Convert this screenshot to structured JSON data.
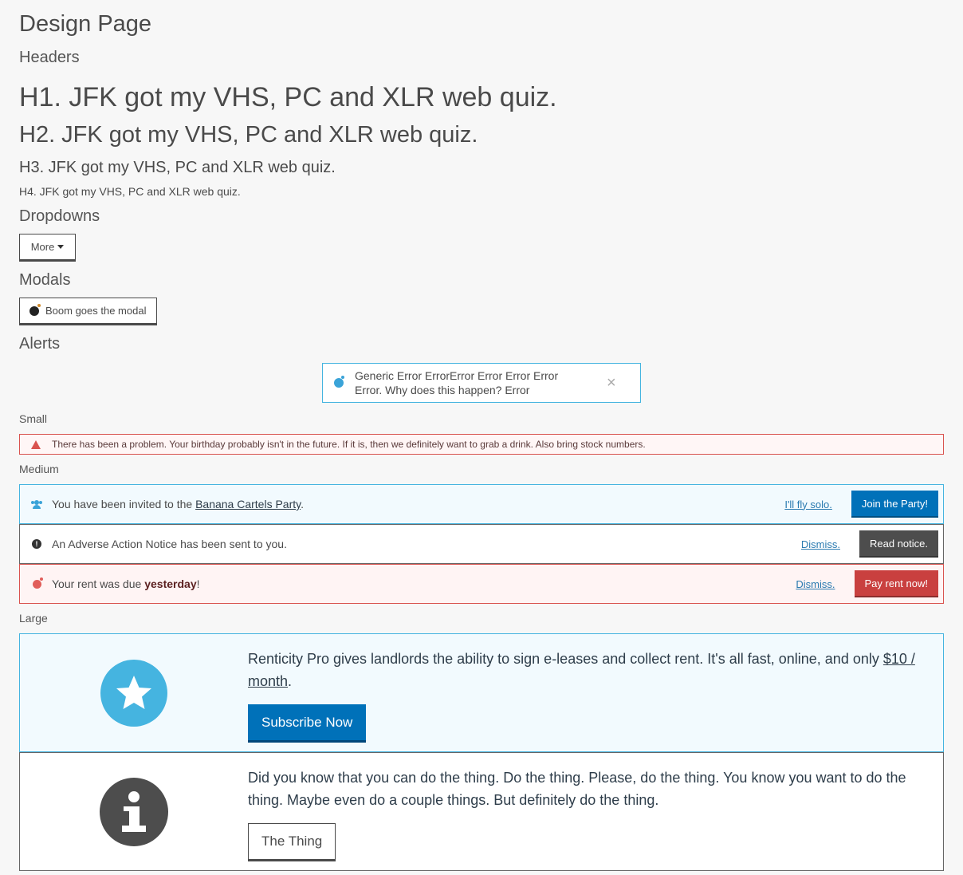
{
  "page": {
    "title": "Design Page"
  },
  "sections": {
    "headers": "Headers",
    "dropdowns": "Dropdowns",
    "modals": "Modals",
    "alerts": "Alerts"
  },
  "headings": {
    "h1": "H1. JFK got my VHS, PC and XLR web quiz.",
    "h2": "H2. JFK got my VHS, PC and XLR web quiz.",
    "h3": "H3. JFK got my VHS, PC and XLR web quiz.",
    "h4": "H4. JFK got my VHS, PC and XLR web quiz."
  },
  "dropdown": {
    "label": "More"
  },
  "modal": {
    "button_label": "Boom goes the modal"
  },
  "generic_alert": {
    "text": "Generic Error ErrorError Error Error Error Error. Why does this happen? Error",
    "close": "×"
  },
  "small": {
    "label": "Small",
    "alert_text": "There has been a problem. Your birthday probably isn't in the future. If it is, then we definitely want to grab a drink. Also bring stock numbers."
  },
  "medium": {
    "label": "Medium",
    "invite": {
      "prefix": "You have been invited to the ",
      "link": "Banana Cartels Party",
      "suffix": ".",
      "secondary": "I'll fly solo.",
      "primary": "Join the Party!"
    },
    "adverse": {
      "text": "An Adverse Action Notice has been sent to you.",
      "secondary": "Dismiss.",
      "primary": "Read notice."
    },
    "rent": {
      "prefix": "Your rent was due ",
      "bold": "yesterday",
      "suffix": "!",
      "secondary": "Dismiss.",
      "primary": "Pay rent now!"
    }
  },
  "large": {
    "label": "Large",
    "pro": {
      "text": "Renticity Pro gives landlords the ability to sign e-leases and collect rent. It's all fast, online, and only ",
      "link": "$10 / month",
      "suffix": ".",
      "button": "Subscribe Now"
    },
    "info": {
      "text": "Did you know that you can do the thing. Do the thing. Please, do the thing. You know you want to do the thing. Maybe even do a couple things. But definitely do the thing.",
      "button": "The Thing",
      "icon_glyph": "i"
    }
  },
  "colors": {
    "info_blue": "#45b4e0",
    "primary_blue": "#0071b9",
    "danger_red": "#d9534f",
    "dark_gray": "#4d4d4d"
  }
}
